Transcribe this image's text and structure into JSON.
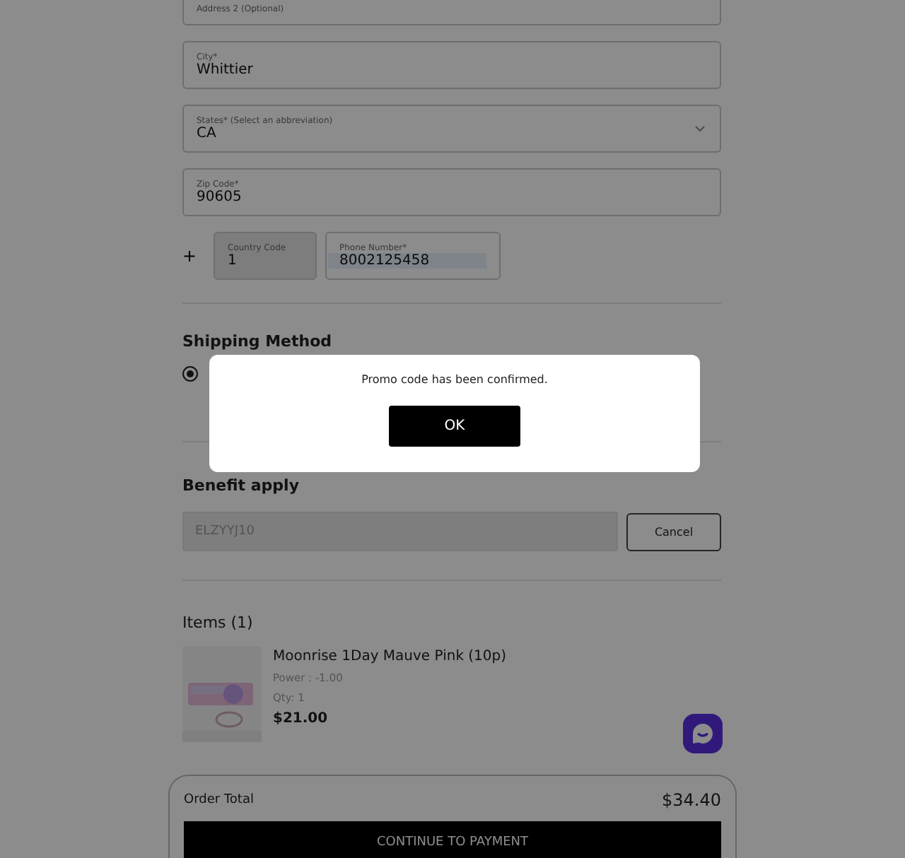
{
  "address_fields": [
    {
      "label": "Address 2 (Optional)",
      "kind": "text"
    },
    {
      "label": "City*",
      "value": "Whittier",
      "kind": "text"
    },
    {
      "label": "States* (Select an abbreviation)",
      "value": "CA",
      "kind": "select"
    },
    {
      "label": "Zip Code*",
      "value": "90605",
      "kind": "text"
    }
  ],
  "phone": {
    "prefix": "+",
    "country_code": {
      "label": "Country Code",
      "value": "1"
    },
    "number": {
      "label": "Phone Number*",
      "value": "8002125458"
    }
  },
  "shipping": {
    "heading": "Shipping Method",
    "options": [
      {
        "selected": true
      }
    ]
  },
  "benefit": {
    "heading": "Benefit apply",
    "code": "ELZYYJ10",
    "cancel": "Cancel"
  },
  "items": {
    "heading": "Items (1)",
    "list": [
      {
        "name": "Moonrise 1Day Mauve Pink (10p)",
        "power": "Power : -1.00",
        "qty": "Qty: 1",
        "price": "$21.00"
      }
    ]
  },
  "order_total": {
    "label": "Order Total",
    "amount": "$34.40",
    "button": "CONTINUE TO PAYMENT"
  },
  "dialog": {
    "message": "Promo code has been confirmed.",
    "button": "OK"
  }
}
